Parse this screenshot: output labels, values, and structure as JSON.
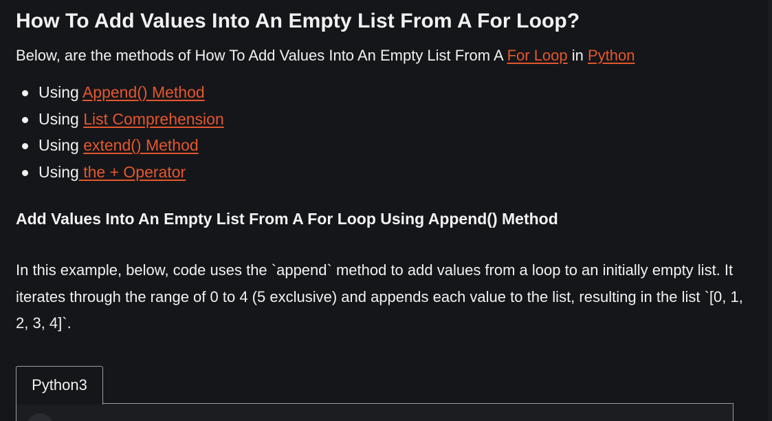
{
  "article": {
    "title": "How To Add Values Into An Empty List From A For Loop?",
    "intro": {
      "prefix": "Below, are the methods of How To Add Values Into An Empty List From A ",
      "link1": "For Loop",
      "middle": " in ",
      "link2": "Python"
    },
    "methods": [
      {
        "prefix": "Using ",
        "link": "Append() Method"
      },
      {
        "prefix": "Using ",
        "link": "List Comprehension"
      },
      {
        "prefix": "Using ",
        "link": "extend() Method"
      },
      {
        "prefix": "Using",
        "link": " the + Operator"
      }
    ],
    "subheading": "Add Values Into An Empty List From A For Loop Using Append() Method",
    "paragraph": "In this example, below, code uses the `append` method to add values from a loop to an initially empty list. It iterates through the range of 0 to 4 (5 exclusive) and appends each value to the list, resulting in the list `[0, 1, 2, 3, 4]`."
  },
  "code_block": {
    "tab_label": "Python3"
  },
  "colors": {
    "background": "#151619",
    "text": "#f2f2f2",
    "link": "#e4572e",
    "border": "#9aa0a6"
  }
}
